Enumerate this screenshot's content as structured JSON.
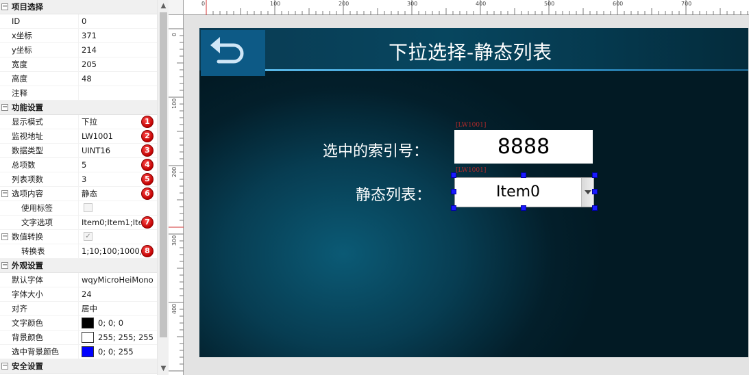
{
  "properties": {
    "sections": {
      "project": "项目选择",
      "function": "功能设置",
      "appearance": "外观设置",
      "security": "安全设置"
    },
    "rows": {
      "id": {
        "key": "ID",
        "value": "0"
      },
      "x": {
        "key": "x坐标",
        "value": "371"
      },
      "y": {
        "key": "y坐标",
        "value": "214"
      },
      "width": {
        "key": "宽度",
        "value": "205"
      },
      "height": {
        "key": "高度",
        "value": "48"
      },
      "note": {
        "key": "注释",
        "value": ""
      },
      "display_mode": {
        "key": "显示模式",
        "value": "下拉",
        "badge": "1"
      },
      "monitor_addr": {
        "key": "监视地址",
        "value": "LW1001",
        "badge": "2"
      },
      "data_type": {
        "key": "数据类型",
        "value": "UINT16",
        "badge": "3"
      },
      "total_items": {
        "key": "总项数",
        "value": "5",
        "badge": "4"
      },
      "list_items": {
        "key": "列表项数",
        "value": "3",
        "badge": "5"
      },
      "option_content": {
        "key": "选项内容",
        "value": "静态",
        "badge": "6"
      },
      "use_tag": {
        "key": "使用标签",
        "value": ""
      },
      "text_options": {
        "key": "文字选项",
        "value": "Item0;Item1;Ite",
        "badge": "7"
      },
      "value_convert": {
        "key": "数值转换",
        "value": "✓"
      },
      "convert_table": {
        "key": "转换表",
        "value": "1;10;100;1000;1",
        "badge": "8"
      },
      "default_font": {
        "key": "默认字体",
        "value": "wqyMicroHeiMono"
      },
      "font_size": {
        "key": "字体大小",
        "value": "24"
      },
      "align": {
        "key": "对齐",
        "value": "居中"
      },
      "text_color": {
        "key": "文字颜色",
        "value": "0; 0; 0",
        "swatch": "#000000"
      },
      "bg_color": {
        "key": "背景颜色",
        "value": "255; 255; 255",
        "swatch": "#ffffff"
      },
      "sel_bg_color": {
        "key": "选中背景颜色",
        "value": "0; 0; 255",
        "swatch": "#0000ff"
      }
    }
  },
  "ruler": {
    "h_labels": [
      "0",
      "100",
      "200",
      "300",
      "400",
      "500",
      "600",
      "700"
    ],
    "v_labels": [
      "0",
      "100",
      "200",
      "300",
      "400"
    ]
  },
  "screen": {
    "title": "下拉选择-静态列表",
    "index_label": "选中的索引号：",
    "index_tag": "[LW1001]",
    "index_value": "8888",
    "list_label": "静态列表：",
    "list_tag": "[LW1001]",
    "dropdown_value": "Item0"
  },
  "colors": {
    "badge": "#cc0000",
    "selection_handle": "#0000ff",
    "screen_bg": "#06394d"
  }
}
